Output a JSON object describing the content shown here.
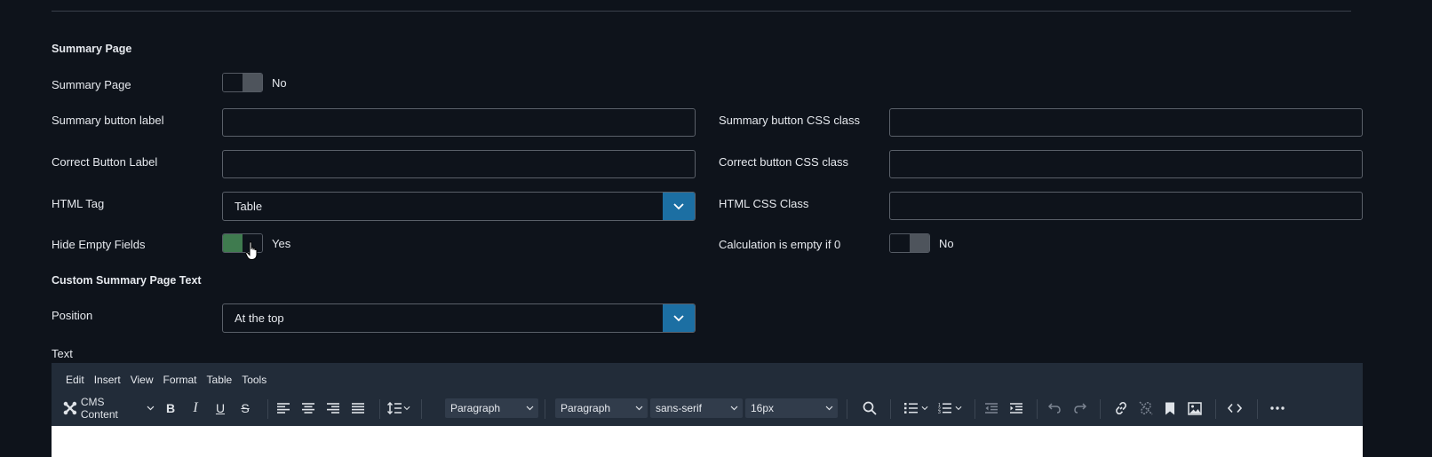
{
  "summary_section": {
    "title": "Summary Page"
  },
  "fields": {
    "summary_page": {
      "label": "Summary Page",
      "value": "No"
    },
    "summary_button_label": {
      "label": "Summary button label",
      "value": ""
    },
    "summary_button_css": {
      "label": "Summary button CSS class",
      "value": ""
    },
    "correct_button_label": {
      "label": "Correct Button Label",
      "value": ""
    },
    "correct_button_css": {
      "label": "Correct button CSS class",
      "value": ""
    },
    "html_tag": {
      "label": "HTML Tag",
      "value": "Table"
    },
    "html_css_class": {
      "label": "HTML CSS Class",
      "value": ""
    },
    "hide_empty_fields": {
      "label": "Hide Empty Fields",
      "value": "Yes"
    },
    "calc_empty_if_zero": {
      "label": "Calculation is empty if 0",
      "value": "No"
    }
  },
  "custom_section": {
    "title": "Custom Summary Page Text"
  },
  "position": {
    "label": "Position",
    "value": "At the top"
  },
  "text": {
    "label": "Text"
  },
  "editor": {
    "menu": [
      "Edit",
      "Insert",
      "View",
      "Format",
      "Table",
      "Tools"
    ],
    "cms_content": "CMS Content",
    "block_format_1": "Paragraph",
    "block_format_2": "Paragraph",
    "font_family": "sans-serif",
    "font_size": "16px"
  },
  "colors": {
    "accent": "#1c6fa3",
    "toggle_on": "#3f7b4f",
    "background": "#0e131b",
    "editor_bar": "#222c39"
  }
}
